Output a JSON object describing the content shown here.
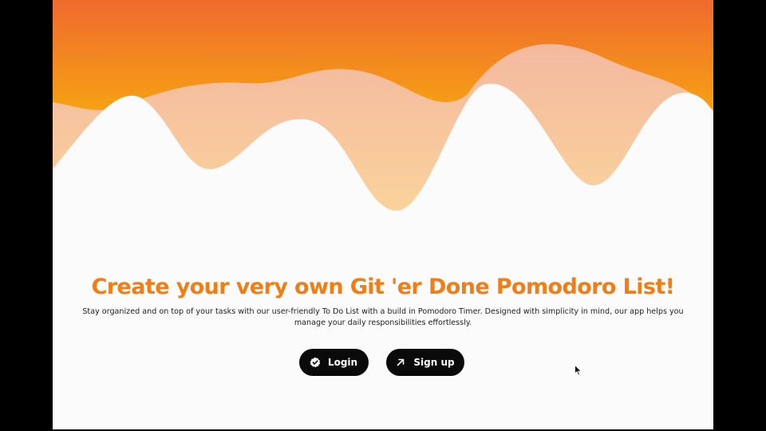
{
  "hero": {
    "title": "Create your very own Git 'er Done Pomodoro List!",
    "description": "Stay organized and on top of your tasks with our user-friendly To Do List with a build in Pomodoro Timer. Designed with simplicity in mind, our app helps you manage your daily responsibilities effortlessly."
  },
  "actions": {
    "login_label": "Login",
    "signup_label": "Sign up"
  },
  "icons": {
    "login": "check-badge-icon",
    "signup": "arrow-up-right-icon"
  },
  "colors": {
    "title": "#f07d16",
    "button_bg": "#0a0a0a",
    "wave_top": "#ef6a2e",
    "wave_bottom": "#f7a90f",
    "wave_light": "#f5c1a2"
  }
}
